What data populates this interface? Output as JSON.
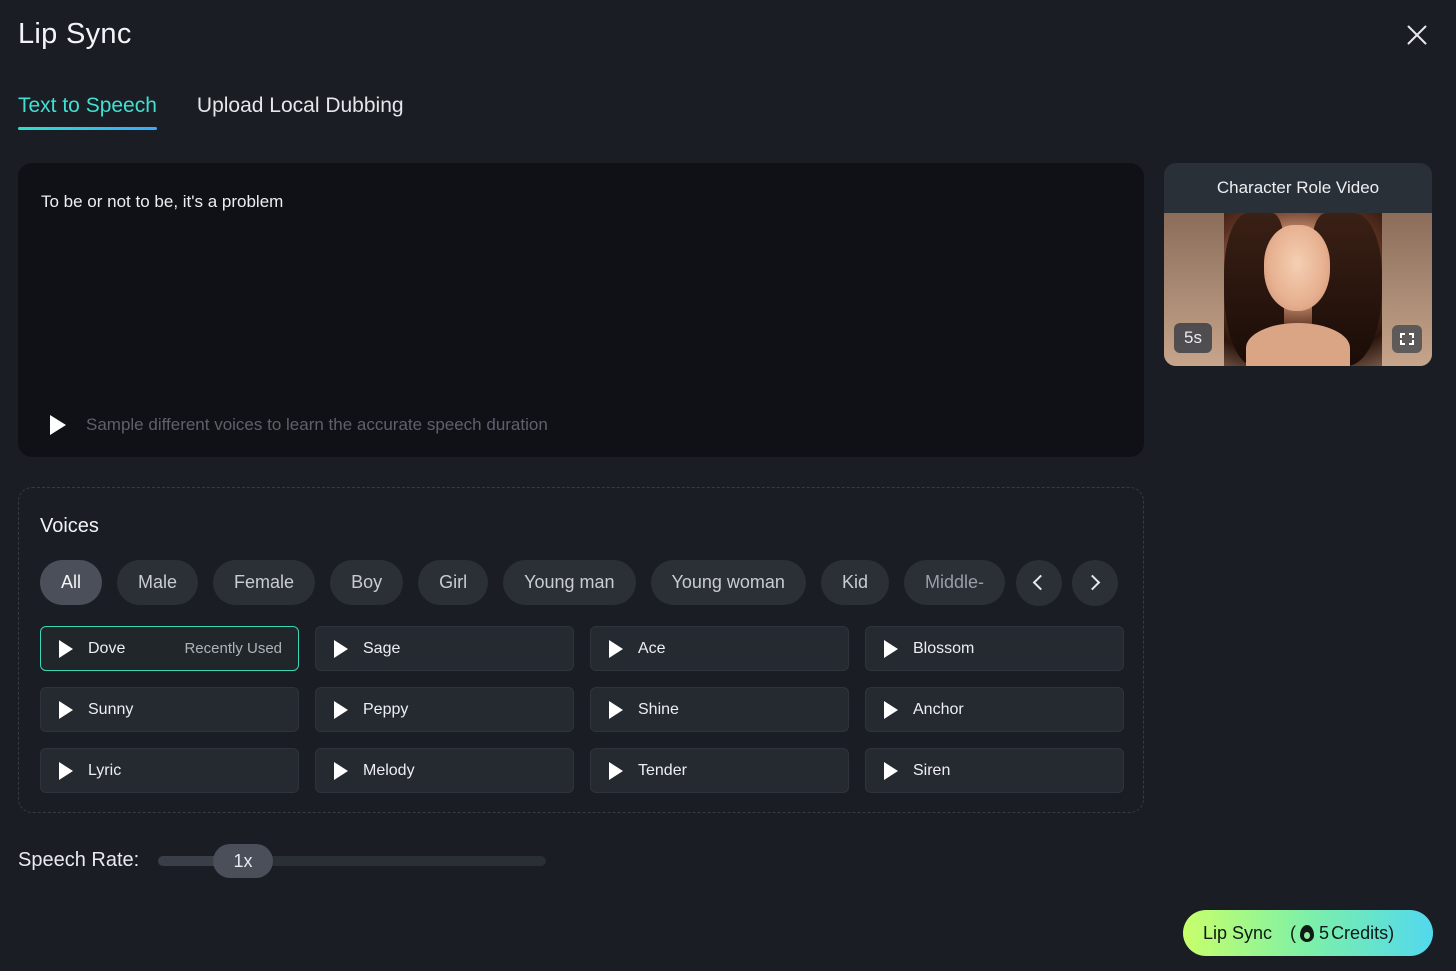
{
  "header": {
    "title": "Lip Sync"
  },
  "tabs": [
    {
      "label": "Text to Speech",
      "active": true
    },
    {
      "label": "Upload Local Dubbing",
      "active": false
    }
  ],
  "editor": {
    "text": "To be or not to be, it's a problem",
    "sample_hint": "Sample different voices to learn the accurate speech duration"
  },
  "character": {
    "title": "Character Role Video",
    "duration": "5s"
  },
  "voices": {
    "title": "Voices",
    "filters": [
      "All",
      "Male",
      "Female",
      "Boy",
      "Girl",
      "Young man",
      "Young woman",
      "Kid",
      "Middle-"
    ],
    "active_filter": "All",
    "items": [
      {
        "name": "Dove",
        "tag": "Recently Used",
        "selected": true
      },
      {
        "name": "Sage"
      },
      {
        "name": "Ace"
      },
      {
        "name": "Blossom"
      },
      {
        "name": "Sunny"
      },
      {
        "name": "Peppy"
      },
      {
        "name": "Shine"
      },
      {
        "name": "Anchor"
      },
      {
        "name": "Lyric"
      },
      {
        "name": "Melody"
      },
      {
        "name": "Tender"
      },
      {
        "name": "Siren"
      }
    ]
  },
  "speech_rate": {
    "label": "Speech Rate:",
    "value": "1x"
  },
  "action": {
    "label": "Lip Sync",
    "credits_open": "(",
    "credits": "5",
    "credits_label": "Credits)"
  },
  "colors": {
    "accent": "#3fe0d2",
    "cta_start": "#c8ff6a",
    "cta_end": "#52d8ee"
  }
}
